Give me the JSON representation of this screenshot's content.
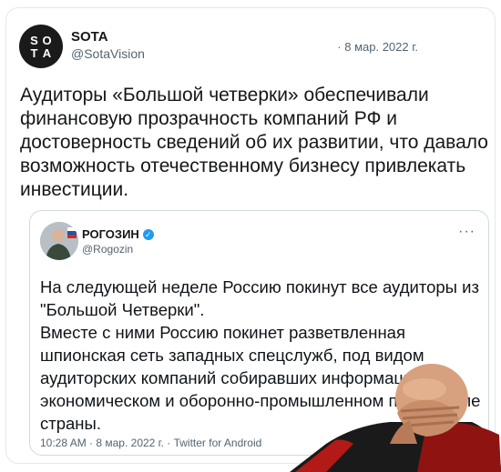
{
  "tweet": {
    "avatar_text": [
      "S",
      "O",
      "T",
      "A"
    ],
    "name": "SOTA",
    "handle": "@SotaVision",
    "date": "· 8 мар. 2022 г.",
    "text": "Аудиторы «Большой четверки» обеспечивали финансовую прозрачность компаний РФ и достоверность сведений об их развитии, что давало возможность отечественному бизнесу привлекать инвестиции."
  },
  "quote": {
    "name": "РОГОЗИН",
    "verified_icon": "verified-badge-icon",
    "handle": "@Rogozin",
    "more": "···",
    "text": "На следующей неделе Россию покинут все аудиторы из \"Большой Четверки\".\nВместе с ними Россию покинет разветвленная шпионская сеть западных спецслужб, под видом аудиторских компаний собиравших информацию об экономическом и оборонно-промышленном потенциале страны.",
    "meta": "10:28 AM · 8 мар. 2022 г. · Twitter for Android"
  },
  "colors": {
    "border": "#e1e8ed",
    "secondary_text": "#536471",
    "verified": "#1d9bf0"
  }
}
